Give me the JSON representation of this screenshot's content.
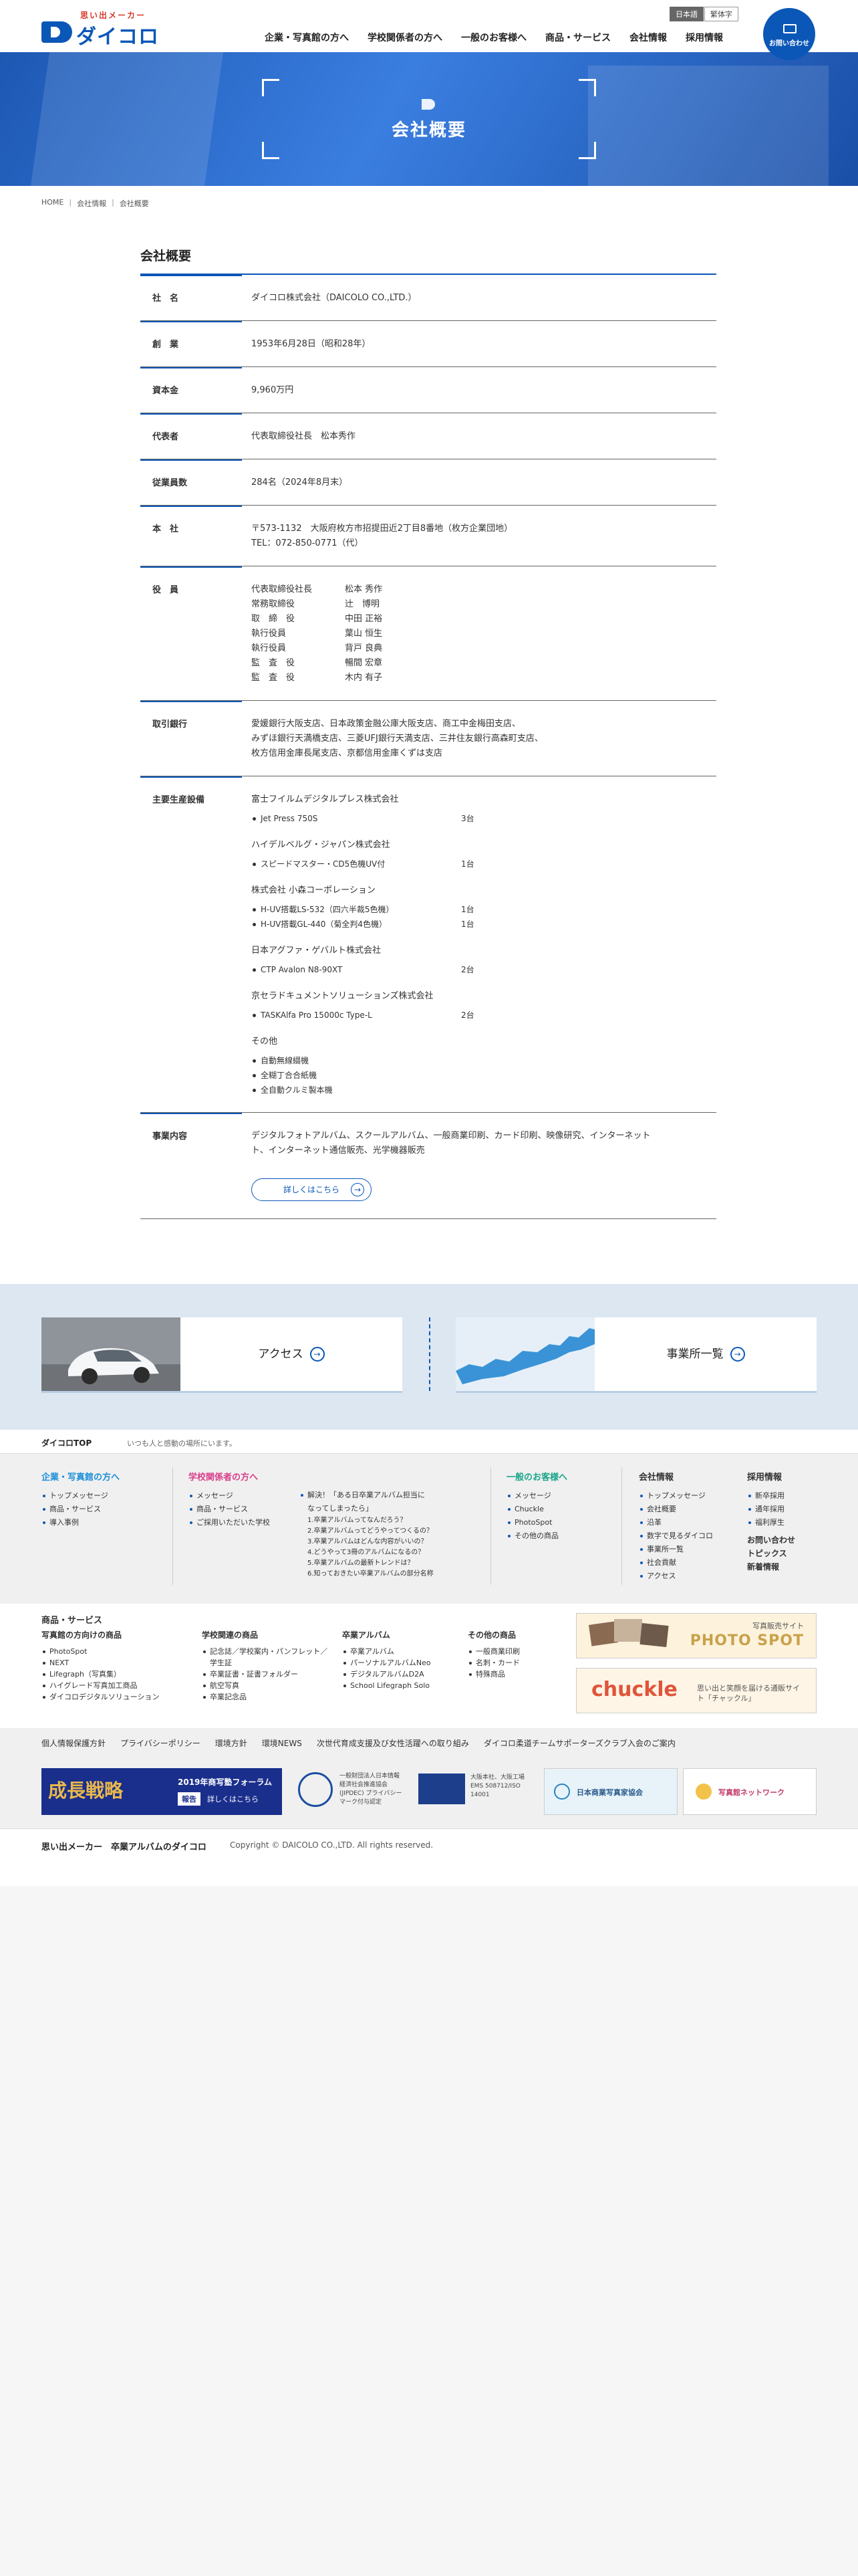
{
  "header": {
    "logo_tagline": "思い出メーカー",
    "logo_name": "ダイコロ",
    "nav": [
      "企業・写真館の方へ",
      "学校関係者の方へ",
      "一般のお客様へ",
      "商品・サービス",
      "会社情報",
      "採用情報"
    ],
    "lang_ja": "日本語",
    "lang_zh": "繁体字",
    "contact_label": "お問い合わせ"
  },
  "hero": {
    "title": "会社概要"
  },
  "breadcrumb": [
    "HOME",
    "会社情報",
    "会社概要"
  ],
  "main": {
    "section_title": "会社概要",
    "rows": {
      "name": {
        "label": "社　名",
        "value": "ダイコロ株式会社（DAICOLO CO.,LTD.）"
      },
      "founded": {
        "label": "創　業",
        "value": "1953年6月28日（昭和28年）"
      },
      "capital": {
        "label": "資本金",
        "value": "9,960万円"
      },
      "rep": {
        "label": "代表者",
        "value": "代表取締役社長　松本秀作"
      },
      "employees": {
        "label": "従業員数",
        "value": "284名（2024年8月末）"
      },
      "hq": {
        "label": "本　社",
        "line1": "〒573-1132　大阪府枚方市招提田近2丁目8番地（枚方企業団地）",
        "line2": "TEL：072-850-0771（代）"
      },
      "officers": {
        "label": "役　員",
        "items": [
          {
            "title": "代表取締役社長",
            "name": "松本 秀作"
          },
          {
            "title": "常務取締役",
            "name": "辻　博明"
          },
          {
            "title": "取　締　役",
            "name": "中田 正裕"
          },
          {
            "title": "執行役員",
            "name": "葉山 恒生"
          },
          {
            "title": "執行役員",
            "name": "背戸 良典"
          },
          {
            "title": "監　査　役",
            "name": "暢間 宏章"
          },
          {
            "title": "監　査　役",
            "name": "木内 有子"
          }
        ]
      },
      "banks": {
        "label": "取引銀行",
        "lines": [
          "愛媛銀行大阪支店、日本政策金融公庫大阪支店、商工中金梅田支店、",
          "みずほ銀行天満橋支店、三菱UFJ銀行天満支店、三井住友銀行高森町支店、",
          "枚方信用金庫長尾支店、京都信用金庫くずは支店"
        ]
      },
      "equipment": {
        "label": "主要生産設備",
        "groups": [
          {
            "company": "富士フイルムデジタルプレス株式会社",
            "items": [
              {
                "name": "Jet Press 750S",
                "qty": "3台"
              }
            ]
          },
          {
            "company": "ハイデルベルグ・ジャパン株式会社",
            "items": [
              {
                "name": "スピードマスター・CD5色機UV付",
                "qty": "1台"
              }
            ]
          },
          {
            "company": "株式会社 小森コーポレーション",
            "items": [
              {
                "name": "H-UV搭載LS-532（四六半裁5色機）",
                "qty": "1台"
              },
              {
                "name": "H-UV搭載GL-440（菊全判4色機）",
                "qty": "1台"
              }
            ]
          },
          {
            "company": "日本アグファ・ゲバルト株式会社",
            "items": [
              {
                "name": "CTP Avalon N8-90XT",
                "qty": "2台"
              }
            ]
          },
          {
            "company": "京セラドキュメントソリューションズ株式会社",
            "items": [
              {
                "name": "TASKAlfa Pro 15000c Type-L",
                "qty": "2台"
              }
            ]
          },
          {
            "company": "その他",
            "items": [
              {
                "name": "自動無線綴機",
                "qty": ""
              },
              {
                "name": "全糊丁合合紙機",
                "qty": ""
              },
              {
                "name": "全自動クルミ製本機",
                "qty": ""
              }
            ]
          }
        ]
      },
      "business": {
        "label": "事業内容",
        "lines": [
          "デジタルフォトアルバム、スクールアルバム、一般商業印刷、カード印刷、映像研究、インターネット",
          "ト、インターネット通信販売、光学機器販売"
        ],
        "more": "詳しくはこちら"
      }
    }
  },
  "band": {
    "access": "アクセス",
    "offices": "事業所一覧"
  },
  "footer": {
    "top_logo": "ダイコロTOP",
    "top_tagline": "いつも人と感動の場所にいます。",
    "col_corp": {
      "title": "企業・写真館の方へ",
      "items": [
        "トップメッセージ",
        "商品・サービス",
        "導入事例"
      ]
    },
    "col_school": {
      "title": "学校関係者の方へ",
      "items": [
        "メッセージ",
        "商品・サービス",
        "ご採用いただいた学校"
      ]
    },
    "col_faq": {
      "title": "解決！「ある日卒業アルバム担当に",
      "title2": "なってしまったら」",
      "items": [
        "1.卒業アルバムってなんだろう？",
        "2.卒業アルバムってどうやってつくるの？",
        "3.卒業アルバムはどんな内容がいいの？",
        "4.どうやって3冊のアルバムになるの？",
        "5.卒業アルバムの最新トレンドは？",
        "6.知っておきたい卒業アルバムの部分名称"
      ]
    },
    "col_general": {
      "title": "一般のお客様へ",
      "items": [
        "メッセージ",
        "Chuckle",
        "PhotoSpot",
        "その他の商品"
      ]
    },
    "col_company": {
      "title": "会社情報",
      "items": [
        "トップメッセージ",
        "会社概要",
        "沿革",
        "数字で見るダイコロ",
        "事業所一覧",
        "社会貢献",
        "アクセス"
      ]
    },
    "col_recruit": {
      "title": "採用情報",
      "items": [
        "新卒採用",
        "通年採用",
        "福利厚生"
      ],
      "extra": [
        "お問い合わせ",
        "トピックス",
        "新着情報"
      ]
    },
    "products": {
      "title": "商品・サービス",
      "c1": {
        "title": "写真館の方向けの商品",
        "items": [
          "PhotoSpot",
          "NEXT",
          "Lifegraph（写真集）",
          "ハイグレード写真加工商品",
          "ダイコロデジタルソリューション"
        ]
      },
      "c2": {
        "title": "学校関連の商品",
        "items": [
          "記念誌／学校案内・パンフレット／学生証",
          "卒業証書・証書フォルダー",
          "航空写真",
          "卒業記念品"
        ]
      },
      "c3": {
        "title": "卒業アルバム",
        "items": [
          "卒業アルバム",
          "パーソナルアルバムNeo",
          "デジタルアルバムD2A",
          "School Lifegraph Solo"
        ]
      },
      "c4": {
        "title": "その他の商品",
        "items": [
          "一般商業印刷",
          "名刺・カード",
          "特殊商品"
        ]
      }
    },
    "banner_photospot_sub": "写真販売サイト",
    "banner_photospot": "PHOTO SPOT",
    "banner_chuckle": "chuckle",
    "banner_chuckle_sub": "思い出と笑顔を届ける通販サイト「チャックル」",
    "policy": [
      "個人情報保護方針",
      "プライバシーポリシー",
      "環境方針",
      "環境NEWS",
      "次世代育成支援及び女性活躍への取り組み",
      "ダイコロ柔道チームサポーターズクラブ入会のご案内"
    ],
    "ban_growth": "成長戦略",
    "ban_forum": "2019年商写塾フォーラム",
    "ban_report": "報告",
    "ban_detail": "詳しくはこちら",
    "ban_pmark": "一般財団法人日本情報経済社会推進協会(JIPDEC) プライバシーマーク付与認定",
    "ban_iso": "大阪本社、大阪工場 EMS 508712/ISO 14001",
    "ban_jppa": "日本商業写真家協会",
    "ban_network": "写真館ネットワーク",
    "bottom_left": "思い出メーカー　卒業アルバムのダイコロ",
    "copyright": "Copyright © DAICOLO CO.,LTD. All rights reserved."
  }
}
